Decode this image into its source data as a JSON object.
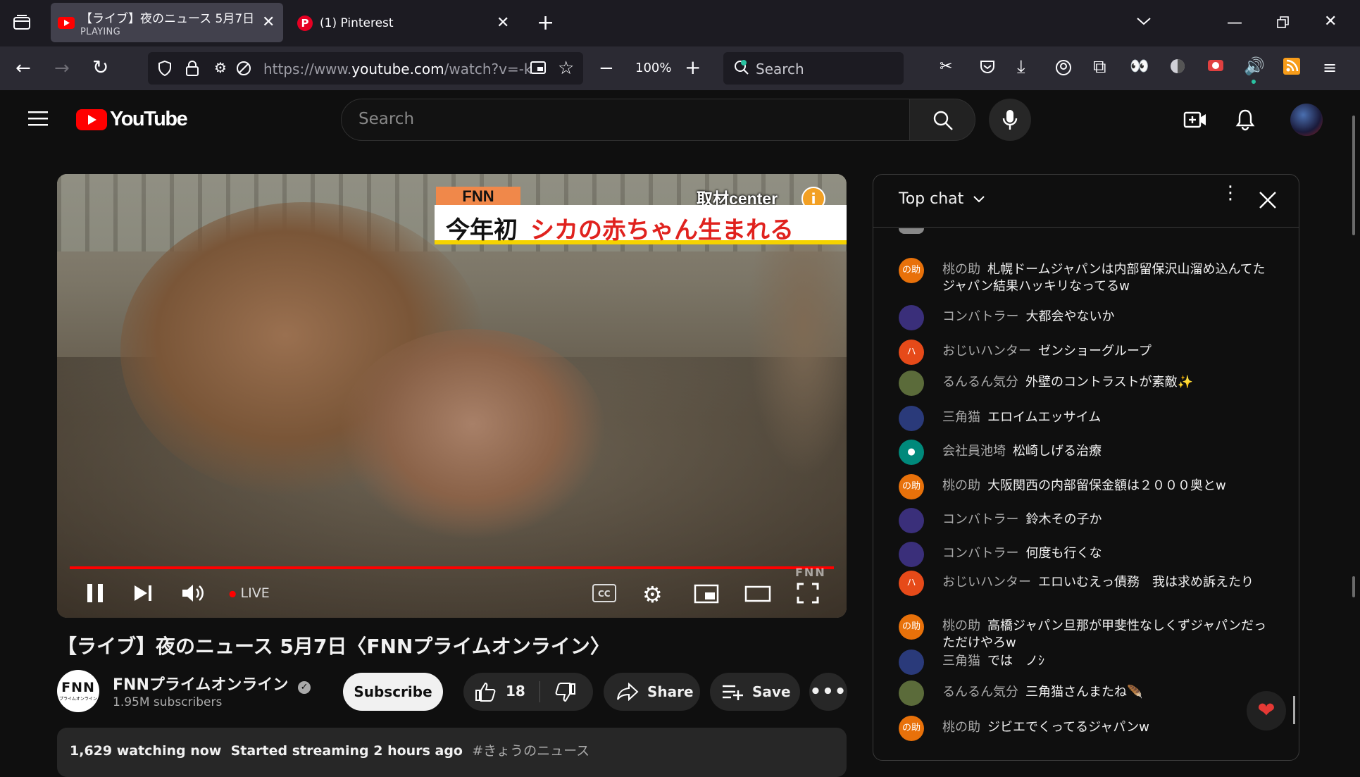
{
  "browser": {
    "tabs": [
      {
        "title": "【ライブ】夜のニュース 5月7日",
        "subtitle": "PLAYING",
        "active": true
      },
      {
        "title": "(1) Pinterest",
        "active": false
      }
    ],
    "url_prefix": "https://www.",
    "url_domain": "youtube.com",
    "url_rest": "/watch?v=-kH",
    "zoom": "100%",
    "search_placeholder": "Search"
  },
  "youtube": {
    "logo_text": "YouTube",
    "search_placeholder": "Search"
  },
  "video": {
    "overlay_brand": "FNN",
    "overlay_center": "取材center",
    "overlay_headline_black": "今年初",
    "overlay_headline_red": "シカの赤ちゃん生まれる",
    "live_label": "LIVE",
    "watermark": "FNN",
    "progress": 1.0,
    "title": "【ライブ】夜のニュース 5月7日〈FNNプライムオンライン〉"
  },
  "channel": {
    "avatar_text": "FNN",
    "avatar_subtext": "プライムオンライン",
    "name": "FNNプライムオンライン",
    "subscribers": "1.95M subscribers",
    "subscribe_label": "Subscribe",
    "likes": "18",
    "share_label": "Share",
    "save_label": "Save"
  },
  "info": {
    "watching": "1,629 watching now",
    "started": "Started streaming 2 hours ago",
    "hashtag": "#きょうのニュース"
  },
  "chat": {
    "header": "Top chat",
    "messages": [
      {
        "author": "桃の助",
        "text": "札幌ドームジャパンは内部留保沢山溜め込んてたジャパン結果ハッキリなってるw",
        "avatar": "の助",
        "color": "#e8710a"
      },
      {
        "author": "コンバトラー",
        "text": "大都会やないか",
        "avatar": "",
        "color": "#3a2f7a"
      },
      {
        "author": "おじいハンター",
        "text": "ゼンショーグループ",
        "avatar": "ハ",
        "color": "#e64a19"
      },
      {
        "author": "るんるん気分",
        "text": "外壁のコントラストが素敵✨",
        "avatar": "",
        "color": "#5b6b3a"
      },
      {
        "author": "三角猫",
        "text": "エロイムエッサイム",
        "avatar": "",
        "color": "#2a3a7a"
      },
      {
        "author": "会社員池埼",
        "text": "松崎しげる治療",
        "avatar": "●",
        "color": "#00897b"
      },
      {
        "author": "桃の助",
        "text": "大阪関西の内部留保金額は２０００奥とw",
        "avatar": "の助",
        "color": "#e8710a"
      },
      {
        "author": "コンバトラー",
        "text": "鈴木その子か",
        "avatar": "",
        "color": "#3a2f7a"
      },
      {
        "author": "コンバトラー",
        "text": "何度も行くな",
        "avatar": "",
        "color": "#3a2f7a"
      },
      {
        "author": "おじいハンター",
        "text": "エロいむえっ債務　我は求め訴えたり",
        "avatar": "ハ",
        "color": "#e64a19"
      },
      {
        "author": "桃の助",
        "text": "高橋ジャパン旦那が甲斐性なしくずジャパンだっただけやろw",
        "avatar": "の助",
        "color": "#e8710a"
      },
      {
        "author": "三角猫",
        "text": "では　ノｼ",
        "avatar": "",
        "color": "#2a3a7a"
      },
      {
        "author": "るんるん気分",
        "text": "三角猫さんまたね🪶",
        "avatar": "",
        "color": "#5b6b3a"
      },
      {
        "author": "桃の助",
        "text": "ジビエでくってるジャパンw",
        "avatar": "の助",
        "color": "#e8710a"
      }
    ],
    "reaction_icon": "heart-icon"
  }
}
